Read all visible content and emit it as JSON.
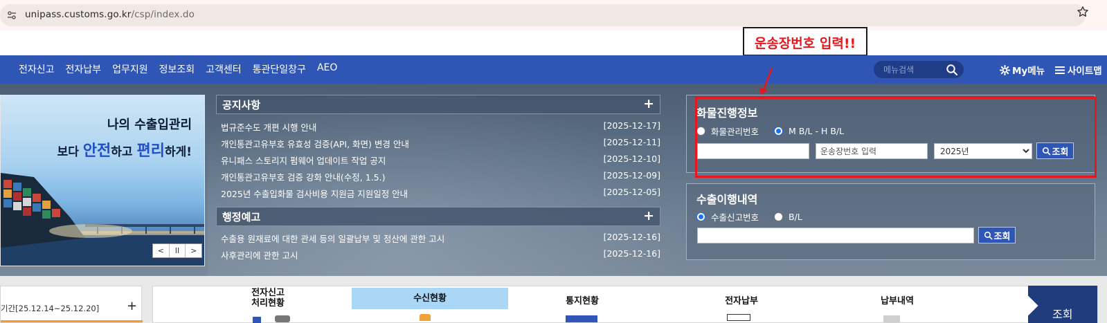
{
  "browser": {
    "url_host": "unipass.customs.go.kr",
    "url_path": "/csp/index.do"
  },
  "callout": {
    "text": "운송장번호 입력!!"
  },
  "nav": {
    "items": [
      "전자신고",
      "전자납부",
      "업무지원",
      "정보조회",
      "고객센터",
      "통관단일창구",
      "AEO"
    ],
    "search_placeholder": "메뉴검색",
    "mymenu_label": "My메뉴",
    "sitemap_label": "사이트맵"
  },
  "banner": {
    "line1": "나의 수출입관리",
    "line2_pre": "보다 ",
    "line2_accent1": "안전",
    "line2_mid": "하고 ",
    "line2_accent2": "편리",
    "line2_post": "하게!",
    "ctrl_prev": "<",
    "ctrl_pause": "II",
    "ctrl_next": ">"
  },
  "notices": {
    "title": "공지사항",
    "plus": "+",
    "items": [
      {
        "title": "법규준수도 개편 시행 안내",
        "date": "[2025-12-17]"
      },
      {
        "title": "개인통관고유부호 유효성 검증(API, 화면) 변경 안내",
        "date": "[2025-12-11]"
      },
      {
        "title": "유니패스 스토리지 펌웨어 업데이트 작업 공지",
        "date": "[2025-12-10]"
      },
      {
        "title": "개인통관고유부호 검증 강화 안내(수정, 1.5.)",
        "date": "[2025-12-09]"
      },
      {
        "title": "2025년 수출입화물 검사비용 지원금 지원일정 안내",
        "date": "[2025-12-05]"
      }
    ]
  },
  "admin_notices": {
    "title": "행정예고",
    "plus": "+",
    "items": [
      {
        "title": "수출용 원재료에 대한 관세 등의 일괄납부 및 정산에 관한 고시",
        "date": "[2025-12-16]"
      },
      {
        "title": "사후관리에 관한 고시",
        "date": "[2025-12-16]"
      }
    ]
  },
  "cargo": {
    "title": "화물진행정보",
    "radio1": "화물관리번호",
    "radio2": "M B/L - H B/L",
    "input2_placeholder": "운송장번호 입력",
    "year": "2025년",
    "button": "조회"
  },
  "export": {
    "title": "수출이행내역",
    "radio1": "수출신고번호",
    "radio2": "B/L",
    "button": "조회"
  },
  "bottom": {
    "period": "기간[25.12.14~25.12.20]",
    "plus": "+",
    "tab1_line1": "전자신고",
    "tab1_line2": "처리현황",
    "tab2": "수신현황",
    "tab3": "통지현황",
    "tab4": "전자납부",
    "tab5": "납부내역",
    "query": "조회"
  },
  "colors": {
    "nav_bg": "#2f56b4",
    "highlight_red": "#e5181e",
    "active_tab": "#a9d7f5"
  }
}
